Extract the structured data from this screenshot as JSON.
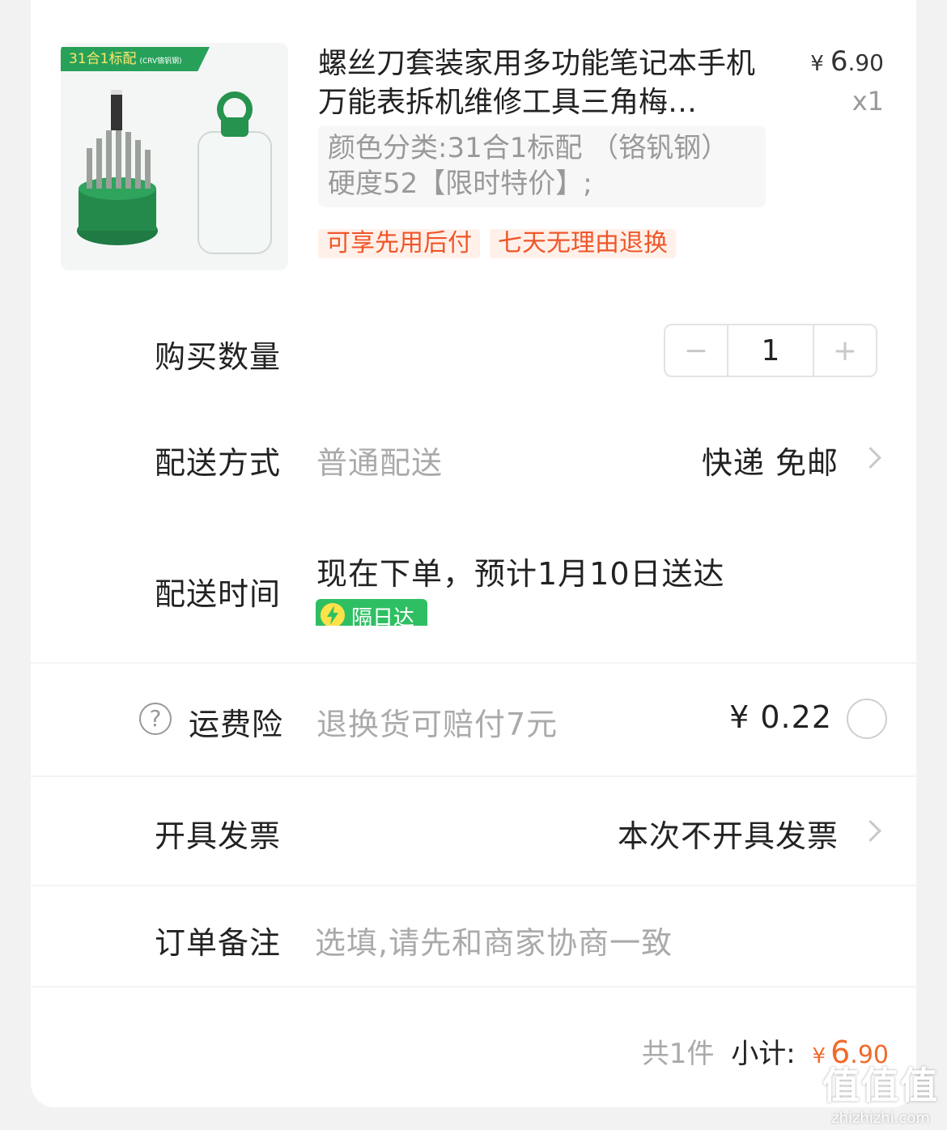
{
  "product": {
    "thumb_label": "31合1标配",
    "thumb_label_small": "(CRV铬钒钢)",
    "title": "螺丝刀套装家用多功能笔记本手机万能表拆机维修工具三角梅…",
    "price_symbol": "¥",
    "price_int": "6",
    "price_dec": ".90",
    "quantity": "x1",
    "sku": "颜色分类:31合1标配 （铬钒钢）硬度52【限时特价】;",
    "tags": [
      "可享先用后付",
      "七天无理由退换"
    ]
  },
  "quantity_row": {
    "label": "购买数量",
    "value": "1",
    "minus": "−",
    "plus": "+"
  },
  "delivery": {
    "label": "配送方式",
    "method": "普通配送",
    "value": "快递 免邮"
  },
  "delivery_time": {
    "label": "配送时间",
    "text": "现在下单，预计1月10日送达",
    "badge": "隔日达"
  },
  "insurance": {
    "label": "运费险",
    "help": "?",
    "desc": "退换货可赔付7元",
    "price": "¥ 0.22"
  },
  "invoice": {
    "label": "开具发票",
    "value": "本次不开具发票"
  },
  "note": {
    "label": "订单备注",
    "placeholder": "选填,请先和商家协商一致"
  },
  "summary": {
    "count": "共1件",
    "subtotal_label": "小计:",
    "symbol": "¥",
    "int": "6",
    "dec": ".90"
  },
  "watermark": {
    "big": "值值值",
    "small": "zhizhizhi.com"
  },
  "colors": {
    "accent": "#f06a2a",
    "green": "#2fbf63",
    "tag_bg": "#fff1ea"
  }
}
